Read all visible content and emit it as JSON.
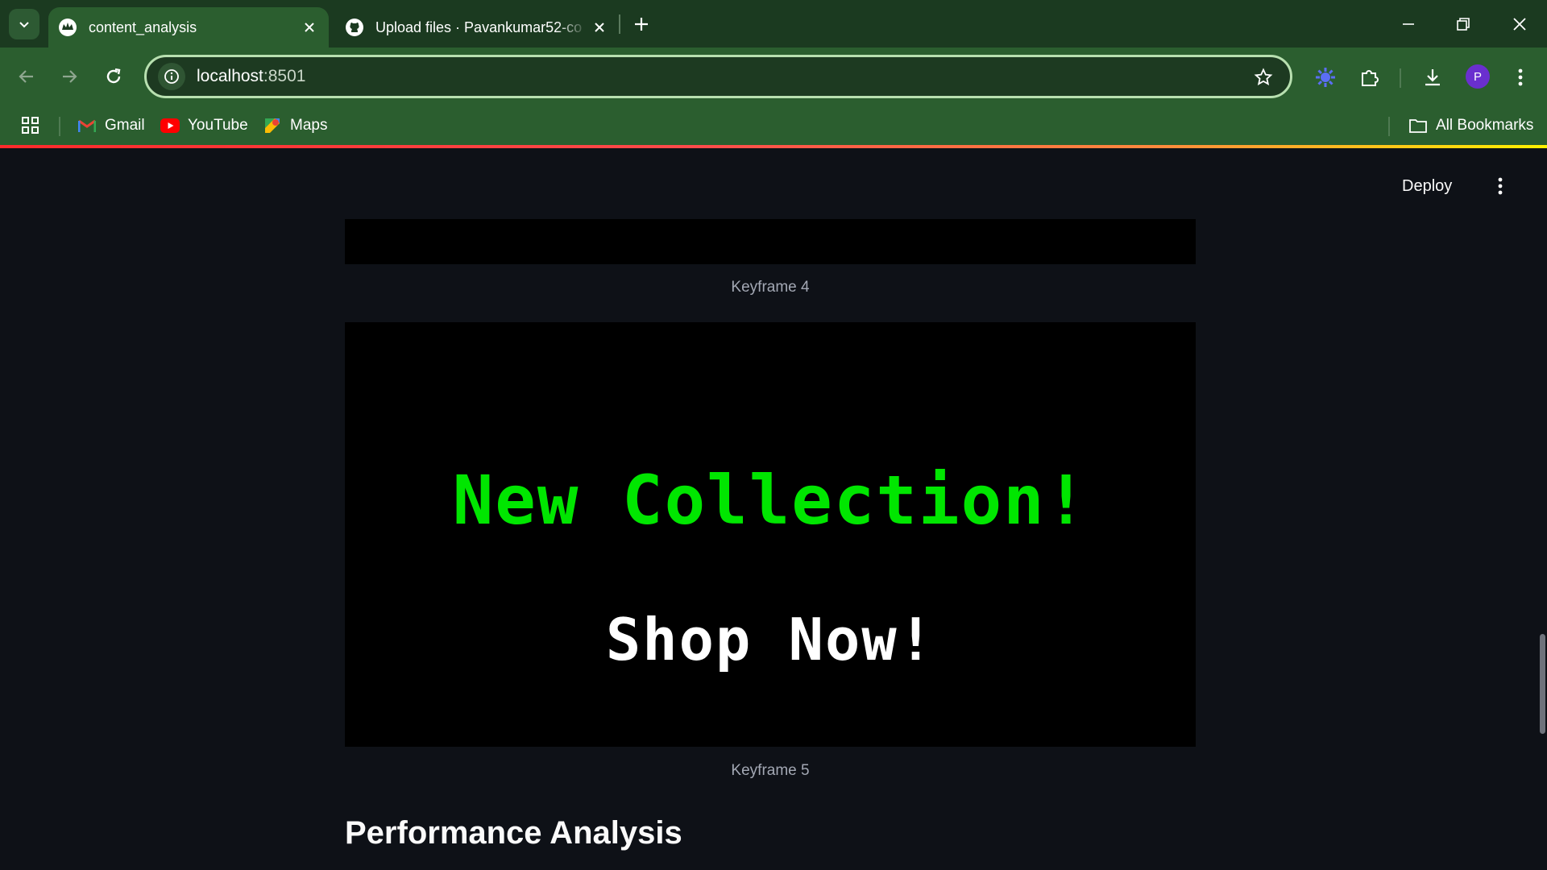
{
  "browser": {
    "tabs": [
      {
        "title": "content_analysis",
        "icon": "streamlit-crown-icon",
        "active": true
      },
      {
        "title": "Upload files · Pavankumar52-co",
        "icon": "github-icon",
        "active": false
      }
    ],
    "address": {
      "host": "localhost",
      "port": ":8501"
    },
    "bookmarks": [
      {
        "label": "Gmail",
        "icon": "gmail-icon"
      },
      {
        "label": "YouTube",
        "icon": "youtube-icon"
      },
      {
        "label": "Maps",
        "icon": "maps-icon"
      }
    ],
    "all_bookmarks_label": "All Bookmarks",
    "profile_initial": "P",
    "colors": {
      "chrome_dark": "#1b3a20",
      "chrome": "#2b5e2f",
      "omnibox_border": "#b8e0b0",
      "avatar": "#6a2fcf"
    }
  },
  "app": {
    "deploy_label": "Deploy",
    "keyframe4_caption": "Keyframe 4",
    "keyframe5": {
      "headline": "New Collection!",
      "cta": "Shop Now!",
      "caption": "Keyframe 5",
      "colors": {
        "headline": "#00e600",
        "cta": "#ffffff",
        "background": "#000000"
      }
    },
    "section_heading": "Performance Analysis",
    "colors": {
      "background": "#0e1117",
      "text": "#fafafa",
      "caption": "#a3a8b4"
    }
  }
}
